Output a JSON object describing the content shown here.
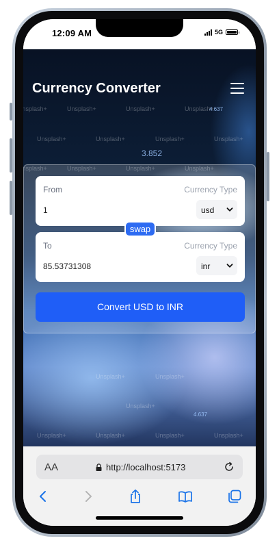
{
  "status_bar": {
    "time": "12:09 AM",
    "network": "5G"
  },
  "app": {
    "title": "Currency Converter",
    "watermark": "Unsplash+",
    "bg_numbers": [
      "4.637",
      "3.852",
      "4.637"
    ]
  },
  "converter": {
    "from": {
      "label": "From",
      "currency_type_label": "Currency Type",
      "amount": "1",
      "currency": "usd"
    },
    "swap_label": "swap",
    "to": {
      "label": "To",
      "currency_type_label": "Currency Type",
      "amount": "85.53731308",
      "currency": "inr"
    },
    "convert_label": "Convert USD to INR"
  },
  "browser": {
    "text_size_label": "AA",
    "url": "http://localhost:5173",
    "icons": [
      "text-size-icon",
      "lock-icon",
      "reload-icon",
      "back-icon",
      "forward-icon",
      "share-icon",
      "bookmarks-icon",
      "tabs-icon"
    ]
  },
  "colors": {
    "accent": "#1f5ef7",
    "swap": "#2d6bf2",
    "safari_icon": "#1a73e8"
  }
}
